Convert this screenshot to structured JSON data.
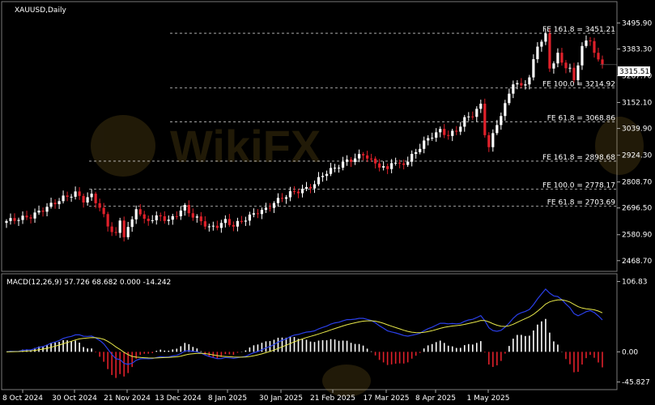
{
  "chart_data": {
    "type": "candlestick",
    "title": "XAUUSD,Daily",
    "price_axis": {
      "labels": [
        "3495.90",
        "3383.30",
        "3267.70",
        "3152.10",
        "3039.90",
        "2924.30",
        "2808.70",
        "2696.50",
        "2580.90",
        "2468.70"
      ],
      "ylim": [
        2440,
        3560
      ]
    },
    "current_price": "3315.51",
    "fib_levels": [
      {
        "label": "FE 161.8 = 3451.21",
        "value": 3451.21
      },
      {
        "label": "FE 100.0 = 3214.92",
        "value": 3214.92
      },
      {
        "label": "FE 61.8 = 3068.86",
        "value": 3068.86
      },
      {
        "label": "FE 161.8 = 2898.68",
        "value": 2898.68
      },
      {
        "label": "FE 100.0 = 2778.17",
        "value": 2778.17
      },
      {
        "label": "FE 61.8 = 2703.69",
        "value": 2703.69
      }
    ],
    "x_labels": [
      "8 Oct 2024",
      "30 Oct 2024",
      "21 Nov 2024",
      "13 Dec 2024",
      "8 Jan 2025",
      "30 Jan 2025",
      "21 Feb 2025",
      "17 Mar 2025",
      "8 Apr 2025",
      "1 May 2025"
    ],
    "close_path": [
      [
        0,
        2640
      ],
      [
        6,
        2660
      ],
      [
        10,
        2700
      ],
      [
        14,
        2740
      ],
      [
        17,
        2760
      ],
      [
        19,
        2730
      ],
      [
        21,
        2750
      ],
      [
        23,
        2700
      ],
      [
        25,
        2620
      ],
      [
        27,
        2580
      ],
      [
        28,
        2640
      ],
      [
        29,
        2580
      ],
      [
        31,
        2640
      ],
      [
        32,
        2700
      ],
      [
        34,
        2640
      ],
      [
        36,
        2650
      ],
      [
        38,
        2660
      ],
      [
        40,
        2640
      ],
      [
        42,
        2670
      ],
      [
        44,
        2700
      ],
      [
        46,
        2660
      ],
      [
        48,
        2640
      ],
      [
        50,
        2610
      ],
      [
        52,
        2620
      ],
      [
        54,
        2640
      ],
      [
        56,
        2620
      ],
      [
        58,
        2640
      ],
      [
        60,
        2660
      ],
      [
        62,
        2680
      ],
      [
        64,
        2690
      ],
      [
        66,
        2720
      ],
      [
        68,
        2740
      ],
      [
        70,
        2760
      ],
      [
        72,
        2770
      ],
      [
        74,
        2780
      ],
      [
        76,
        2800
      ],
      [
        78,
        2840
      ],
      [
        80,
        2860
      ],
      [
        82,
        2880
      ],
      [
        84,
        2900
      ],
      [
        86,
        2910
      ],
      [
        88,
        2930
      ],
      [
        90,
        2900
      ],
      [
        92,
        2880
      ],
      [
        94,
        2860
      ],
      [
        95,
        2900
      ],
      [
        97,
        2880
      ],
      [
        99,
        2900
      ],
      [
        101,
        2940
      ],
      [
        103,
        2980
      ],
      [
        105,
        3010
      ],
      [
        107,
        3030
      ],
      [
        109,
        3010
      ],
      [
        111,
        3030
      ],
      [
        113,
        3080
      ],
      [
        115,
        3100
      ],
      [
        117,
        3140
      ],
      [
        118,
        3020
      ],
      [
        119,
        2960
      ],
      [
        121,
        3060
      ],
      [
        123,
        3140
      ],
      [
        125,
        3240
      ],
      [
        127,
        3220
      ],
      [
        129,
        3260
      ],
      [
        131,
        3400
      ],
      [
        133,
        3440
      ],
      [
        134,
        3300
      ],
      [
        136,
        3360
      ],
      [
        137,
        3320
      ],
      [
        139,
        3300
      ],
      [
        140,
        3240
      ],
      [
        141,
        3320
      ],
      [
        142,
        3400
      ],
      [
        144,
        3420
      ],
      [
        146,
        3330
      ],
      [
        147,
        3315
      ]
    ],
    "macd": {
      "label": "MACD(12,26,9) 57.726 68.682 0.000 -14.242",
      "axis_labels": [
        "106.83",
        "0.00",
        "-45.827"
      ],
      "ylim": [
        -50,
        110
      ]
    }
  }
}
